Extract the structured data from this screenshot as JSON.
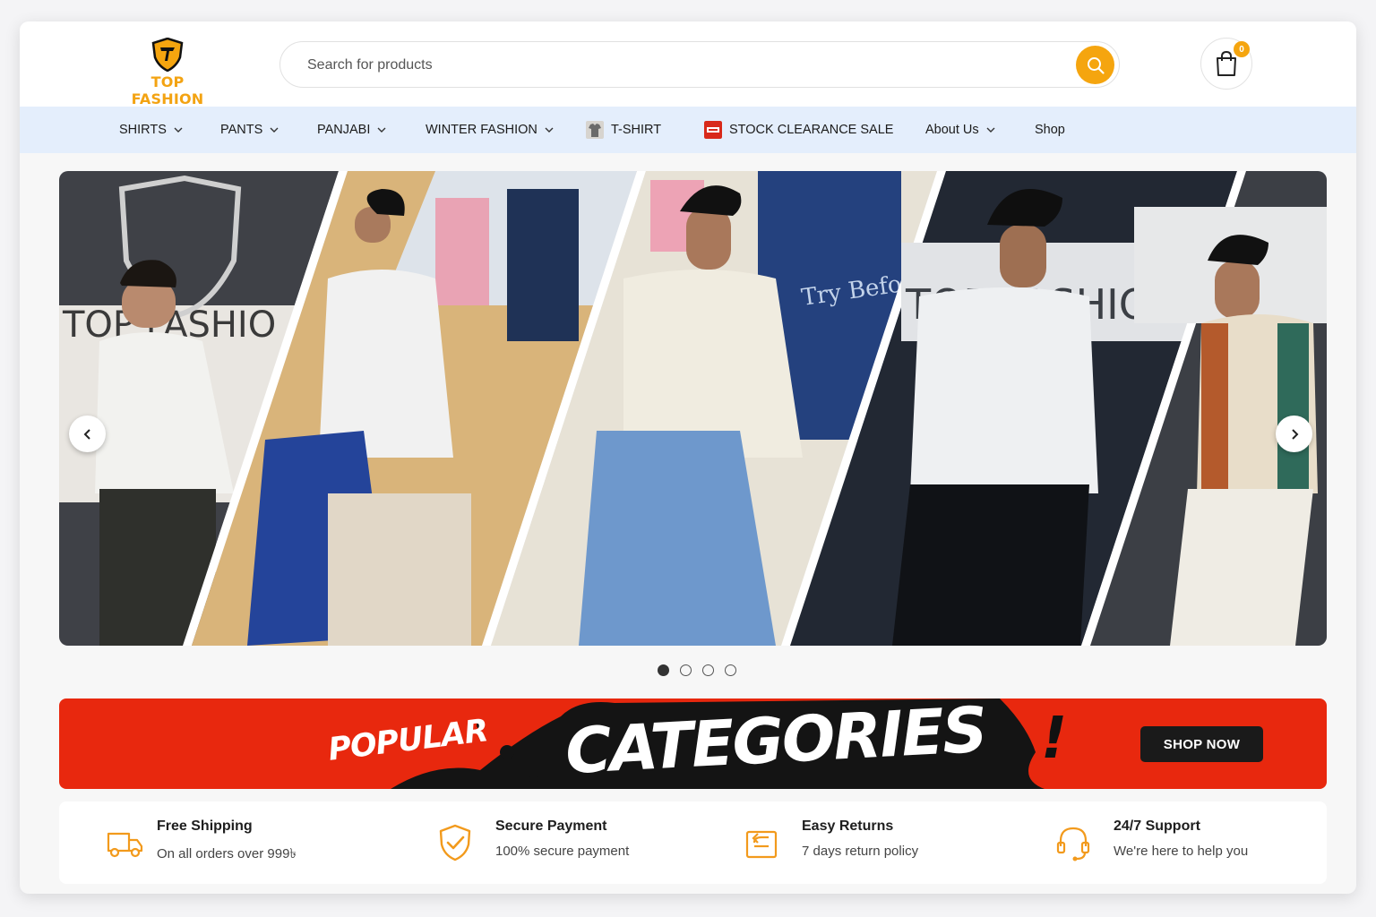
{
  "brand": {
    "name": "TOP FASHION",
    "accent": "#f5a50f"
  },
  "search": {
    "placeholder": "Search for products"
  },
  "cart": {
    "count": "0"
  },
  "nav": {
    "items": [
      {
        "label": "SHIRTS",
        "has_dropdown": true
      },
      {
        "label": "PANTS",
        "has_dropdown": true
      },
      {
        "label": "PANJABI",
        "has_dropdown": true
      },
      {
        "label": "WINTER FASHION",
        "has_dropdown": true
      },
      {
        "label": "T-SHIRT",
        "has_dropdown": false
      },
      {
        "label": "STOCK CLEARANCE SALE",
        "has_dropdown": false
      },
      {
        "label": "About Us",
        "has_dropdown": true
      },
      {
        "label": "Shop",
        "has_dropdown": false
      }
    ]
  },
  "hero": {
    "sign_text_left": "TOP FASHIO",
    "sign_text_right": "TOP FASHION",
    "wall_text": "Try Before You Buy",
    "slide_count": 4,
    "active_slide": 1
  },
  "promo": {
    "small_text": "POPULAR",
    "big_text": "CATEGORIES",
    "exclaim": "!",
    "button": "SHOP NOW"
  },
  "features": [
    {
      "icon": "truck-icon",
      "title": "Free Shipping",
      "subtitle": "On all orders over 999৳"
    },
    {
      "icon": "shield-check-icon",
      "title": "Secure Payment",
      "subtitle": "100% secure payment"
    },
    {
      "icon": "return-icon",
      "title": "Easy Returns",
      "subtitle": "7 days return policy"
    },
    {
      "icon": "headset-icon",
      "title": "24/7 Support",
      "subtitle": "We're here to help you"
    }
  ]
}
